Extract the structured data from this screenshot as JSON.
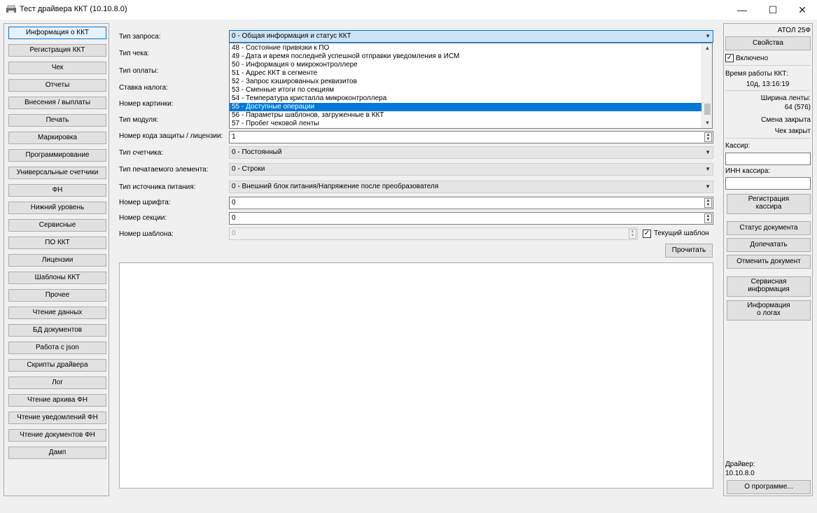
{
  "window": {
    "title": "Тест драйвера ККТ (10.10.8.0)",
    "minimize": "—",
    "maximize": "☐",
    "close": "✕"
  },
  "nav": {
    "items": [
      "Информация о ККТ",
      "Регистрация ККТ",
      "Чек",
      "Отчеты",
      "Внесения / выплаты",
      "Печать",
      "Маркировка",
      "Программирование",
      "Универсальные счетчики",
      "ФН",
      "Нижний уровень",
      "Сервисные",
      "ПО ККТ",
      "Лицензии",
      "Шаблоны ККТ",
      "Прочее",
      "Чтение данных",
      "БД документов",
      "Работа с json",
      "Скрипты драйвера",
      "Лог",
      "Чтение архива ФН",
      "Чтение уведомлений ФН",
      "Чтение документов ФН",
      "Дамп"
    ]
  },
  "form": {
    "request_type_label": "Тип запроса:",
    "request_type_value": "0 - Общая информация и статус ККТ",
    "check_type_label": "Тип чека:",
    "payment_type_label": "Тип оплаты:",
    "tax_rate_label": "Ставка налога:",
    "picture_number_label": "Номер картинки:",
    "module_type_label": "Тип модуля:",
    "protection_code_label": "Номер кода защиты / лицензии:",
    "protection_code_value": "1",
    "counter_type_label": "Тип счетчика:",
    "counter_type_value": "0 - Постоянный",
    "print_element_label": "Тип печатаемого элемента:",
    "print_element_value": "0 - Строки",
    "power_source_label": "Тип источника питания:",
    "power_source_value": "0 - Внешний блок питания/Напряжение после преобразователя",
    "font_number_label": "Номер шрифта:",
    "font_number_value": "0",
    "section_number_label": "Номер секции:",
    "section_number_value": "0",
    "template_number_label": "Номер шаблона:",
    "template_number_value": "0",
    "current_template_label": "Текущий шаблон",
    "current_template_checked": "✓",
    "read_button": "Прочитать"
  },
  "dropdown": {
    "options": [
      "48 - Состояние привязки к ПО",
      "49 - Дата и время последней успешной отправки уведомления в ИСМ",
      "50 - Информация о микроконтроллере",
      "51 - Адрес ККТ в сегменте",
      "52 - Запрос кэшированных реквизитов",
      "53 - Сменные итоги по секциям",
      "54 - Температура кристалла микроконтроллера",
      "55 - Доступные операции",
      "56 - Параметры шаблонов, загруженные в ККТ",
      "57 - Пробег чековой ленты"
    ],
    "selected_index": 7
  },
  "right": {
    "model": "АТОЛ 25Ф",
    "properties_button": "Свойства",
    "enabled_label": "Включено",
    "enabled_checked": "✓",
    "uptime_label": "Время работы ККТ:",
    "uptime_value": "10д, 13:16:19",
    "tape_width_label": "Ширина ленты:",
    "tape_width_value": "64 (576)",
    "shift_status": "Смена закрыта",
    "check_status": "Чек закрыт",
    "cashier_label": "Кассир:",
    "cashier_inn_label": "ИНН кассира:",
    "register_cashier_l1": "Регистрация",
    "register_cashier_l2": "кассира",
    "doc_status_button": "Статус документа",
    "reprint_button": "Допечатать",
    "cancel_doc_button": "Отменить документ",
    "service_info_l1": "Сервисная",
    "service_info_l2": "информация",
    "log_info_l1": "Информация",
    "log_info_l2": "о логах",
    "driver_label": "Драйвер:",
    "driver_version": "10.10.8.0",
    "about_button": "О программе..."
  }
}
